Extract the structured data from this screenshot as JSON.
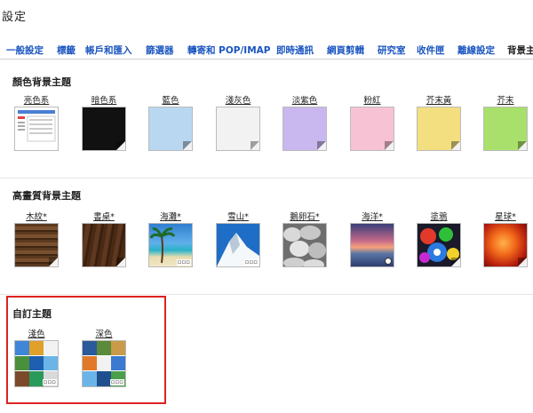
{
  "header": {
    "title": "設定"
  },
  "tabs": [
    {
      "label": "一般設定"
    },
    {
      "label": "標籤"
    },
    {
      "label": "帳戶和匯入"
    },
    {
      "label": "篩選器"
    },
    {
      "label": "轉寄和 POP/IMAP"
    },
    {
      "label": "即時通訊"
    },
    {
      "label": "網頁剪輯"
    },
    {
      "label": "研究室"
    },
    {
      "label": "收件匣"
    },
    {
      "label": "離線設定"
    },
    {
      "label": "背景主題"
    }
  ],
  "sections": {
    "color": {
      "title": "顏色背景主題",
      "items": [
        {
          "label": "亮色系",
          "color": "#ffffff"
        },
        {
          "label": "暗色系",
          "color": "#111111"
        },
        {
          "label": "藍色",
          "color": "#b9d7f0"
        },
        {
          "label": "淺灰色",
          "color": "#f2f2f2"
        },
        {
          "label": "淡紫色",
          "color": "#c9b7ef"
        },
        {
          "label": "粉紅",
          "color": "#f7c2d3"
        },
        {
          "label": "芥末黃",
          "color": "#f3df7f"
        },
        {
          "label": "芥末",
          "color": "#a8e06b"
        }
      ]
    },
    "hd": {
      "title": "高畫質背景主題",
      "items": [
        {
          "label": "木紋*"
        },
        {
          "label": "書桌*"
        },
        {
          "label": "海灘*"
        },
        {
          "label": "雪山*"
        },
        {
          "label": "鵝卵石*"
        },
        {
          "label": "海洋*"
        },
        {
          "label": "塗鴉"
        },
        {
          "label": "星球*"
        }
      ]
    },
    "custom": {
      "title": "自訂主題",
      "items": [
        {
          "label": "淺色"
        },
        {
          "label": "深色"
        }
      ]
    }
  },
  "badge_text": "▫▫▫"
}
